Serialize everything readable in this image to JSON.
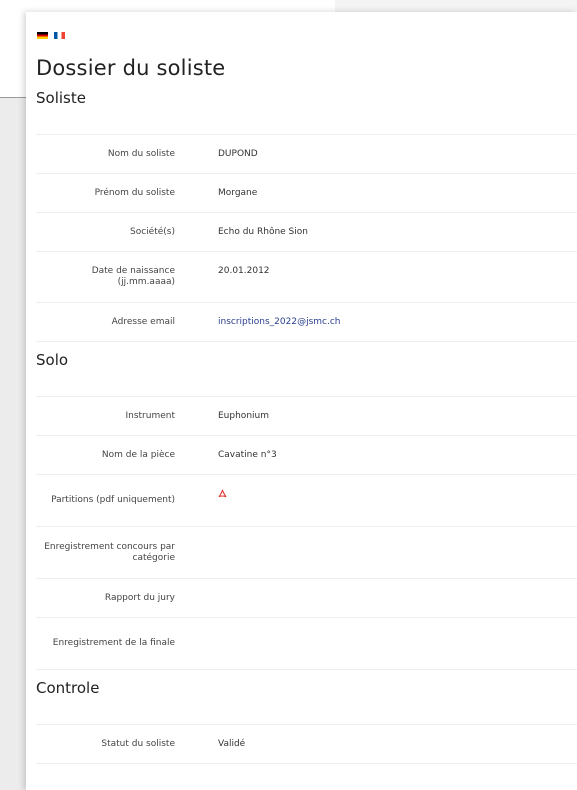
{
  "flags": [
    {
      "name": "flag-de",
      "lang": "de"
    },
    {
      "name": "flag-fr",
      "lang": "fr"
    }
  ],
  "page_title": "Dossier du soliste",
  "sections": {
    "soliste": {
      "title": "Soliste",
      "rows": [
        {
          "label": "Nom du soliste",
          "value": "DUPOND"
        },
        {
          "label": "Prénom du soliste",
          "value": "Morgane"
        },
        {
          "label": "Société(s)",
          "value": "Echo du Rhône Sion"
        },
        {
          "label": "Date de naissance (jj.mm.aaaa)",
          "value": "20.01.2012"
        },
        {
          "label": "Adresse email",
          "value": "inscriptions_2022@jsmc.ch"
        }
      ]
    },
    "solo": {
      "title": "Solo",
      "rows": [
        {
          "label": "Instrument",
          "value": "Euphonium"
        },
        {
          "label": "Nom de la pièce",
          "value": "Cavatine n°3"
        },
        {
          "label": "Partitions (pdf uniquement)",
          "value": ""
        },
        {
          "label": "Enregistrement concours par catégorie",
          "value": ""
        },
        {
          "label": "Rapport du jury",
          "value": ""
        },
        {
          "label": "Enregistrement de la finale",
          "value": ""
        }
      ]
    },
    "controle": {
      "title": "Controle",
      "rows": [
        {
          "label": "Statut du soliste",
          "value": "Validé"
        }
      ]
    }
  },
  "colors": {
    "link": "#2a3f8f",
    "pdf_icon": "#e0312b",
    "divider": "#eeeeee"
  },
  "icons": {
    "partitions": "pdf-icon"
  }
}
